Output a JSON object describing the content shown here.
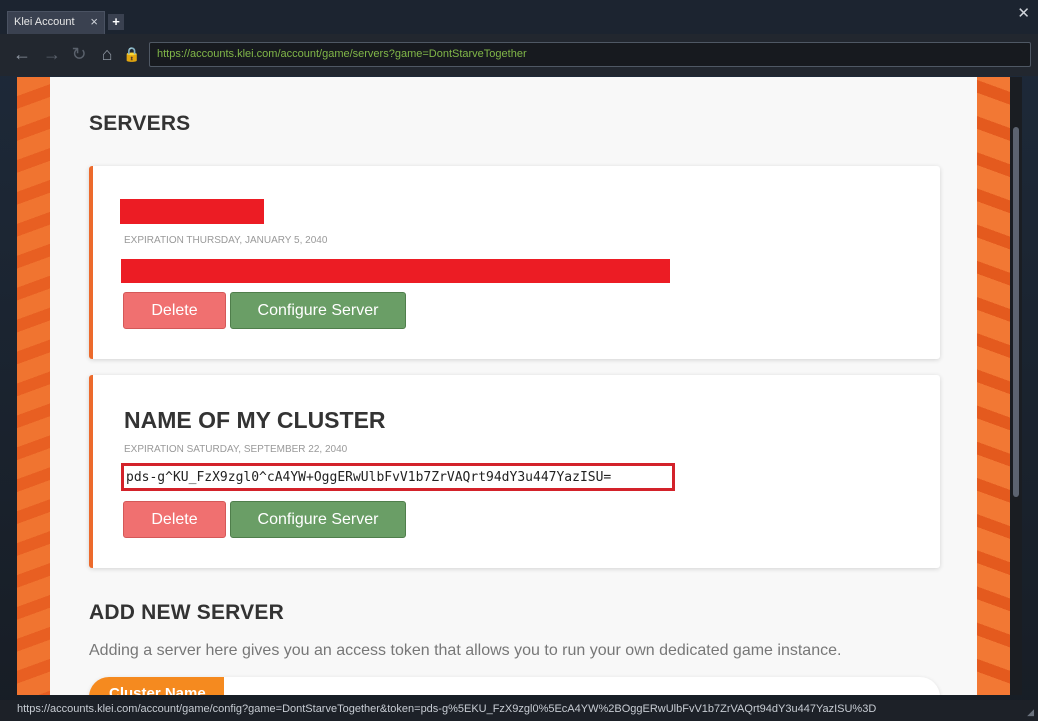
{
  "window": {
    "tab_title": "Klei Account",
    "tab_close": "×",
    "new_tab": "+",
    "close": "✕"
  },
  "nav": {
    "back_icon": "←",
    "forward_icon": "→",
    "reload_icon": "↻",
    "home_icon": "⌂",
    "lock_icon": "🔒",
    "url": "https://accounts.klei.com/account/game/servers?game=DontStarveTogether"
  },
  "page": {
    "servers_heading": "SERVERS",
    "servers": [
      {
        "name": "",
        "expiration": "EXPIRATION THURSDAY, JANUARY 5, 2040",
        "token": "",
        "delete_label": "Delete",
        "configure_label": "Configure Server"
      },
      {
        "name": "NAME OF MY CLUSTER",
        "expiration": "EXPIRATION SATURDAY, SEPTEMBER 22, 2040",
        "token": "pds-g^KU_FzX9zgl0^cA4YW+OggERwUlbFvV1b7ZrVAQrt94dY3u447YazISU=",
        "delete_label": "Delete",
        "configure_label": "Configure Server"
      }
    ],
    "add_heading": "ADD NEW SERVER",
    "add_description": "Adding a server here gives you an access token that allows you to run your own dedicated game instance.",
    "cluster_name_label": "Cluster Name"
  },
  "status": {
    "url": "https://accounts.klei.com/account/game/config?game=DontStarveTogether&token=pds-g%5EKU_FzX9zgl0%5EcA4YW%2BOggERwUlbFvV1b7ZrVAQrt94dY3u447YazISU%3D"
  },
  "colors": {
    "accent": "#ec6a2c",
    "delete": "#f07070",
    "configure": "#6a9e66",
    "redaction": "#ec1c24"
  }
}
